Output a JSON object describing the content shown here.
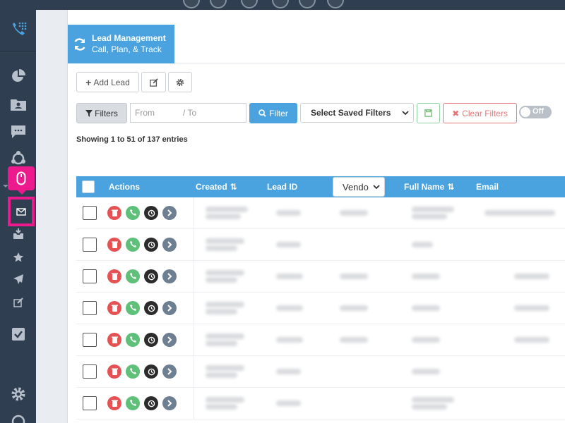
{
  "colors": {
    "sidebar": "#2f3e50",
    "accent": "#4aa3df",
    "highlight": "#ec1a8c",
    "delete": "#e55253",
    "call": "#5fc07a",
    "history": "#2c2c2c",
    "view": "#6e7f92"
  },
  "sidebar": {
    "logo_icon": "phone-grid-icon",
    "items": [
      {
        "name": "pie-chart-icon"
      },
      {
        "name": "contacts-folder-icon"
      },
      {
        "name": "chat-icon"
      },
      {
        "name": "sync-network-icon"
      },
      {
        "name": "mouse-icon",
        "highlighted": true
      },
      {
        "name": "envelope-icon",
        "boxed": true
      },
      {
        "name": "inbox-download-icon"
      },
      {
        "name": "star-icon"
      },
      {
        "name": "send-icon"
      },
      {
        "name": "edit-icon"
      },
      {
        "name": "checkbox-icon"
      },
      {
        "name": "gear-icon"
      }
    ]
  },
  "header": {
    "title": "Lead Management",
    "subtitle": "Call, Plan, & Track",
    "icon": "refresh-icon"
  },
  "toolbar": {
    "add_lead": "Add Lead",
    "edit_icon": "edit-icon",
    "settings_icon": "gear-icon"
  },
  "filters": {
    "filters_label": "Filters",
    "from_placeholder": "From",
    "to_placeholder": "/  To",
    "filter_button": "Filter",
    "saved_filters": "Select Saved Filters",
    "save_icon": "floppy-icon",
    "clear_filters": "Clear Filters",
    "toggle_label": "Off"
  },
  "info": "Showing 1 to 51 of 137 entries",
  "table": {
    "columns": {
      "actions": "Actions",
      "created": "Created",
      "lead_id": "Lead ID",
      "vendor": "Vendo",
      "full_name": "Full Name",
      "email": "Email"
    },
    "row_count": 7
  }
}
